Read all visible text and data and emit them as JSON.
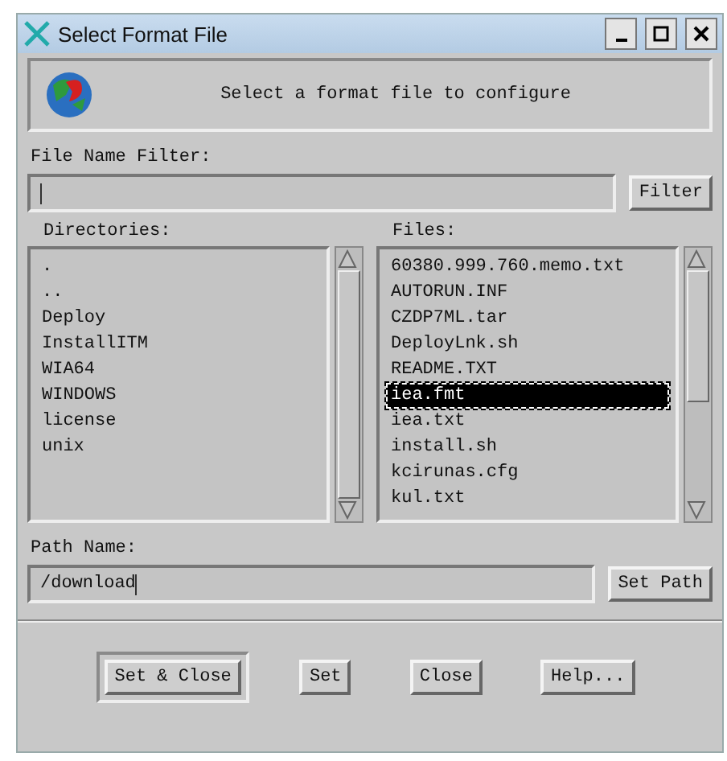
{
  "window": {
    "title": "Select Format File"
  },
  "header": {
    "message": "Select a format file to configure"
  },
  "filter": {
    "label": "File Name Filter:",
    "button": "Filter"
  },
  "directories": {
    "label": "Directories:",
    "items": [
      {
        "name": ".",
        "selected": false
      },
      {
        "name": "..",
        "selected": false
      },
      {
        "name": "Deploy",
        "selected": false
      },
      {
        "name": "InstallITM",
        "selected": false
      },
      {
        "name": "WIA64",
        "selected": false
      },
      {
        "name": "WINDOWS",
        "selected": false
      },
      {
        "name": "license",
        "selected": false
      },
      {
        "name": "unix",
        "selected": false
      }
    ]
  },
  "files": {
    "label": "Files:",
    "items": [
      {
        "name": "60380.999.760.memo.txt",
        "selected": false
      },
      {
        "name": "AUTORUN.INF",
        "selected": false
      },
      {
        "name": "CZDP7ML.tar",
        "selected": false
      },
      {
        "name": "DeployLnk.sh",
        "selected": false
      },
      {
        "name": "README.TXT",
        "selected": false
      },
      {
        "name": "iea.fmt",
        "selected": true
      },
      {
        "name": "iea.txt",
        "selected": false
      },
      {
        "name": "install.sh",
        "selected": false
      },
      {
        "name": "kcirunas.cfg",
        "selected": false
      },
      {
        "name": "kul.txt",
        "selected": false
      }
    ]
  },
  "path": {
    "label": "Path Name:",
    "value": "/download",
    "button": "Set Path"
  },
  "buttons": [
    {
      "label": "Set & Close",
      "default": true
    },
    {
      "label": "Set",
      "default": false
    },
    {
      "label": "Close",
      "default": false
    },
    {
      "label": "Help...",
      "default": false
    }
  ]
}
